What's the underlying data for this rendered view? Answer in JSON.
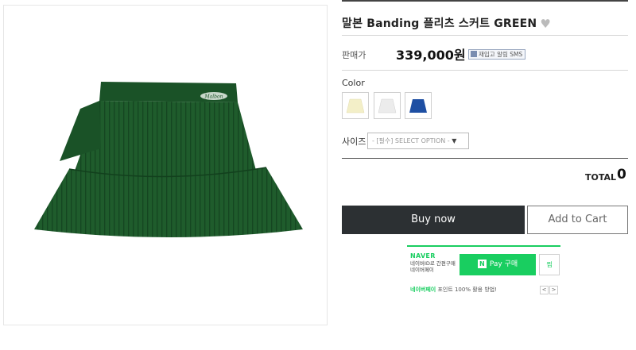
{
  "product": {
    "title": "말본 Banding 플리츠 스커트 GREEN",
    "heart_icon": "heart-icon",
    "price_label": "판매가",
    "price": "339,000원",
    "sms_badge": "재입고 알림 SMS",
    "main_color": "#1f5c2c"
  },
  "options": {
    "color_label": "Color",
    "swatches": [
      {
        "name": "cream",
        "color": "#f3efc8"
      },
      {
        "name": "white",
        "color": "#ececec"
      },
      {
        "name": "blue",
        "color": "#1e4fa3"
      }
    ],
    "size_label": "사이즈",
    "size_select": "- [필수] SELECT OPTION -",
    "size_select_icon": "chevron-down-icon"
  },
  "total": {
    "label": "TOTAL",
    "value": "0"
  },
  "actions": {
    "buy_now": "Buy now",
    "add_to_cart": "Add to Cart"
  },
  "naver": {
    "logo": "NAVER",
    "description": "네이버ID로 간편구매 네이버페이",
    "pay_button": "Pay 구매",
    "pay_n": "N",
    "wish_button": "찜",
    "promo_brand": "네이버페이",
    "promo_text": "포인트 100% 활용 방법!",
    "prev": "<",
    "next": ">",
    "accent": "#19ce60"
  }
}
